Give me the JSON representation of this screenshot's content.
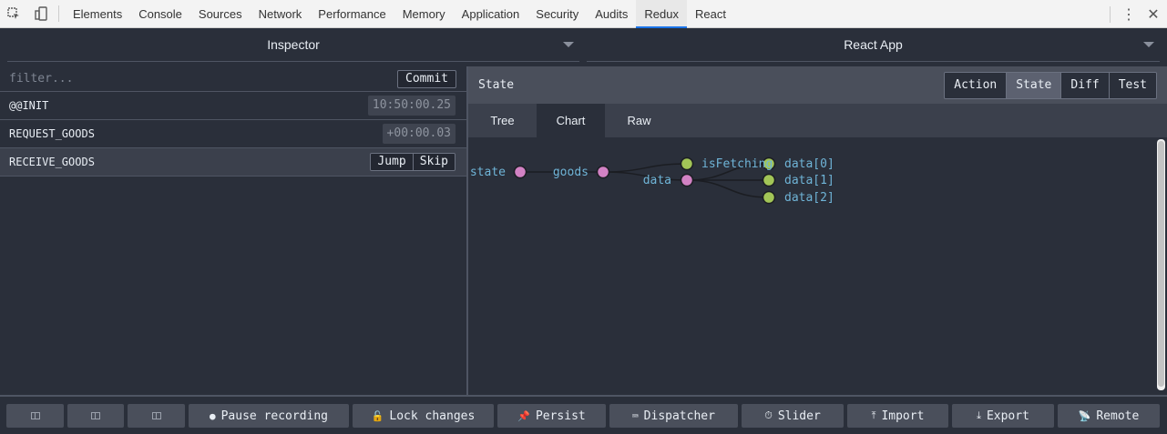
{
  "devtools": {
    "tabs": [
      "Elements",
      "Console",
      "Sources",
      "Network",
      "Performance",
      "Memory",
      "Application",
      "Security",
      "Audits",
      "Redux",
      "React"
    ],
    "active_tab": "Redux"
  },
  "header": {
    "left_selector": "Inspector",
    "right_selector": "React App"
  },
  "left": {
    "filter_placeholder": "filter...",
    "commit_label": "Commit",
    "actions": [
      {
        "name": "@@INIT",
        "time": "10:50:00.25"
      },
      {
        "name": "REQUEST_GOODS",
        "time": "+00:00.03"
      },
      {
        "name": "RECEIVE_GOODS",
        "jump": "Jump",
        "skip": "Skip"
      }
    ]
  },
  "right": {
    "title": "State",
    "modes": [
      "Action",
      "State",
      "Diff",
      "Test"
    ],
    "active_mode": "State",
    "views": [
      "Tree",
      "Chart",
      "Raw"
    ],
    "active_view": "Chart"
  },
  "chart": {
    "nodes": {
      "root": "state",
      "goods": "goods",
      "is_fetching": "isFetching",
      "data": "data",
      "data0": "data[0]",
      "data1": "data[1]",
      "data2": "data[2]"
    },
    "colors": {
      "branch_node": "#d282c4",
      "leaf_node": "#a2c557",
      "label": "#6fb4d7",
      "link": "#1b1d22"
    }
  },
  "toolbar": {
    "pause_label": "Pause recording",
    "lock_label": "Lock changes",
    "persist_label": "Persist",
    "dispatcher_label": "Dispatcher",
    "slider_label": "Slider",
    "import_label": "Import",
    "export_label": "Export",
    "remote_label": "Remote"
  }
}
